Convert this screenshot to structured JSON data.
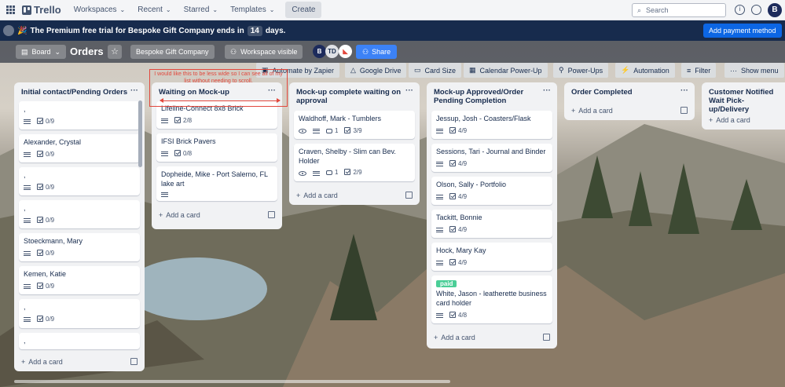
{
  "topbar": {
    "app_name": "Trello",
    "nav": [
      "Workspaces",
      "Recent",
      "Starred",
      "Templates"
    ],
    "create_label": "Create",
    "search_placeholder": "Search",
    "avatar_initial": "B"
  },
  "banner": {
    "text_before": "The Premium free trial for Bespoke Gift Company ends in",
    "days": "14",
    "text_after": "days.",
    "action_label": "Add payment method"
  },
  "boardbar": {
    "view_label": "Board",
    "title": "Orders",
    "workspace_label": "Bespoke Gift Company",
    "visibility_label": "Workspace visible",
    "members": [
      "B",
      "TD"
    ],
    "share_label": "Share"
  },
  "toolbar": {
    "items": [
      "Automate by Zapier",
      "Google Drive",
      "Card Size",
      "Calendar Power-Up",
      "Power-Ups",
      "Automation",
      "Filter",
      "Show menu"
    ]
  },
  "annotation": {
    "text": "I would like this to be less wide so I can see all of my list without needing to scroll."
  },
  "lists": [
    {
      "title": "Initial contact/Pending Orders",
      "add_label": "Add a card",
      "cards": [
        {
          "title": ",",
          "checklist": "0/9"
        },
        {
          "title": "Alexander, Crystal",
          "checklist": "0/9"
        },
        {
          "title": ",",
          "checklist": "0/9"
        },
        {
          "title": ",",
          "checklist": "0/9"
        },
        {
          "title": "Stoeckmann, Mary",
          "checklist": "0/9"
        },
        {
          "title": "Kemen, Katie",
          "checklist": "0/9"
        },
        {
          "title": ",",
          "checklist": "0/9"
        },
        {
          "title": ",",
          "checklist": ""
        }
      ]
    },
    {
      "title": "Waiting on Mock-up",
      "add_label": "Add a card",
      "cards": [
        {
          "title": "Lifeline-Connect 8x8 Brick",
          "checklist": "2/8"
        },
        {
          "title": "IFSI Brick Pavers",
          "checklist": "0/8"
        },
        {
          "title": "Dopheide, Mike - Port Salerno, FL lake art",
          "checklist": ""
        }
      ]
    },
    {
      "title": "Mock-up complete waiting on approval",
      "add_label": "Add a card",
      "cards": [
        {
          "title": "Waldhoff, Mark - Tumblers",
          "comments": "1",
          "checklist": "3/9"
        },
        {
          "title": "Craven, Shelby - Slim can Bev. Holder",
          "comments": "1",
          "checklist": "2/9"
        }
      ]
    },
    {
      "title": "Mock-up Approved/Order Pending Completion",
      "add_label": "Add a card",
      "cards": [
        {
          "title": "Jessup, Josh - Coasters/Flask",
          "checklist": "4/9"
        },
        {
          "title": "Sessions, Tari - Journal and Binder",
          "checklist": "4/9"
        },
        {
          "title": "Olson, Sally - Portfolio",
          "checklist": "4/9"
        },
        {
          "title": "Tackitt, Bonnie",
          "checklist": "4/9"
        },
        {
          "title": "Hock, Mary Kay",
          "checklist": "4/9"
        },
        {
          "title": "White, Jason - leatherette business card holder",
          "label": "paid",
          "checklist": "4/8"
        }
      ]
    },
    {
      "title": "Order Completed",
      "add_label": "Add a card",
      "cards": []
    },
    {
      "title": "Customer Notified Wait Pick-up/Delivery",
      "add_label": "Add a card",
      "cards": []
    }
  ],
  "colors": {
    "banner_bg": "#172b4d",
    "accent": "#0c66e4",
    "label_paid": "#4bce97",
    "annotation": "#e2483d"
  }
}
